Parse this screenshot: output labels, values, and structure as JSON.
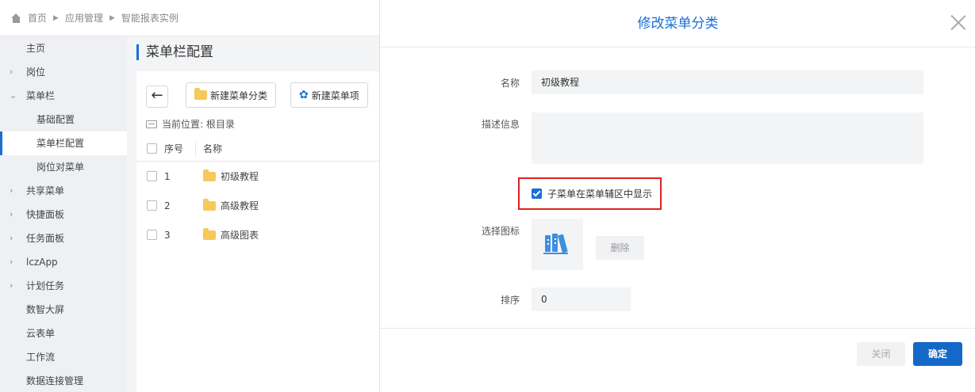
{
  "breadcrumb": {
    "items": [
      "首页",
      "应用管理",
      "智能报表实例"
    ]
  },
  "sidebar": {
    "items": [
      {
        "label": "主页",
        "arrow": ""
      },
      {
        "label": "岗位",
        "arrow": "›"
      },
      {
        "label": "菜单栏",
        "arrow": "⌄"
      },
      {
        "label": "基础配置",
        "arrow": ""
      },
      {
        "label": "菜单栏配置",
        "arrow": ""
      },
      {
        "label": "岗位对菜单",
        "arrow": ""
      },
      {
        "label": "共享菜单",
        "arrow": "›"
      },
      {
        "label": "快捷面板",
        "arrow": "›"
      },
      {
        "label": "任务面板",
        "arrow": "›"
      },
      {
        "label": "lczApp",
        "arrow": "›"
      },
      {
        "label": "计划任务",
        "arrow": "›"
      },
      {
        "label": "数智大屏",
        "arrow": ""
      },
      {
        "label": "云表单",
        "arrow": ""
      },
      {
        "label": "工作流",
        "arrow": ""
      },
      {
        "label": "数据连接管理",
        "arrow": ""
      }
    ]
  },
  "main": {
    "title": "菜单栏配置",
    "back_label": "←",
    "new_category_label": "新建菜单分类",
    "new_item_label": "新建菜单项",
    "location_label": "当前位置: 根目录",
    "table": {
      "headers": [
        "序号",
        "名称"
      ],
      "rows": [
        {
          "num": "1",
          "name": "初级教程"
        },
        {
          "num": "2",
          "name": "高级教程"
        },
        {
          "num": "3",
          "name": "高级图表"
        }
      ]
    }
  },
  "dialog": {
    "title": "修改菜单分类",
    "name_label": "名称",
    "name_value": "初级教程",
    "desc_label": "描述信息",
    "desc_value": "",
    "show_submenu_label": "子菜单在菜单辅区中显示",
    "show_submenu_checked": true,
    "icon_label": "选择图标",
    "icon_name": "books-icon",
    "delete_label": "删除",
    "order_label": "排序",
    "order_value": "0",
    "close_label": "关闭",
    "ok_label": "确定"
  },
  "colors": {
    "accent": "#1a6fd6",
    "highlight_border": "#e02020",
    "folder": "#f7c85a",
    "icon_blue": "#3d8fe0"
  }
}
